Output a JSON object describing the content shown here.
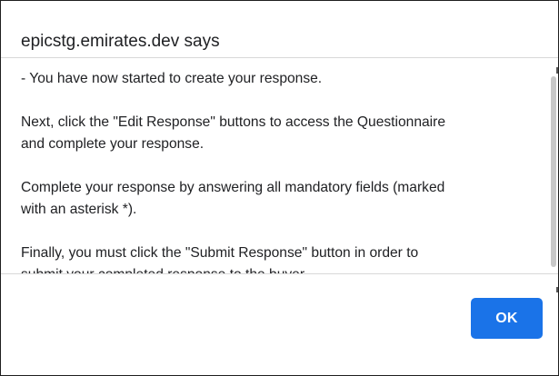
{
  "dialog": {
    "title": "epicstg.emirates.dev says",
    "message_lines": [
      "- You have now started to create your response.",
      "",
      "Next, click the \"Edit Response\" buttons to access the Questionnaire",
      "and complete your response.",
      "",
      "Complete your response by answering all mandatory fields (marked",
      "with an asterisk *).",
      "",
      "Finally, you must click the \"Submit Response\" button in order to",
      "submit your completed response to the buyer."
    ],
    "ok_label": "OK",
    "accent_color": "#1a73e8"
  }
}
